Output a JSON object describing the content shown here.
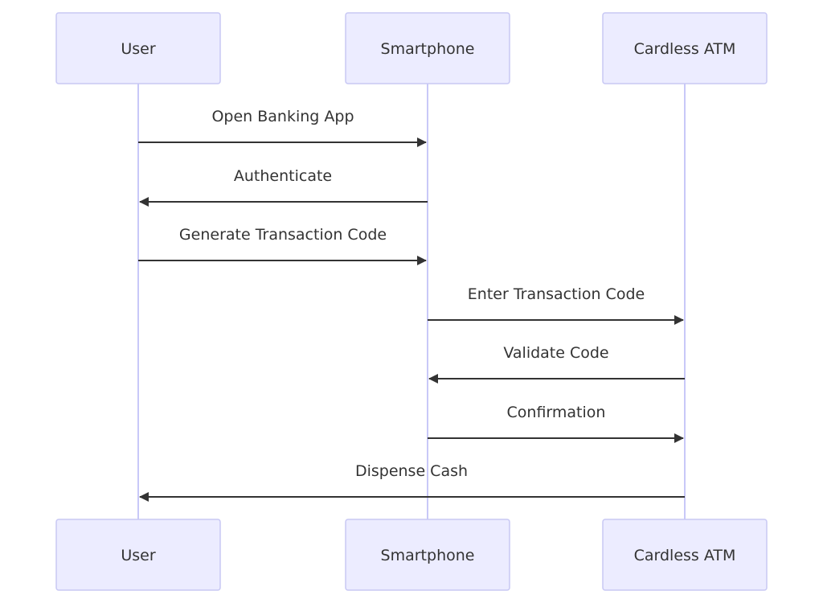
{
  "diagram": {
    "type": "sequence",
    "participants": [
      {
        "id": "user",
        "label": "User"
      },
      {
        "id": "phone",
        "label": "Smartphone"
      },
      {
        "id": "atm",
        "label": "Cardless ATM"
      }
    ],
    "messages": [
      {
        "from": "user",
        "to": "phone",
        "label": "Open Banking App"
      },
      {
        "from": "phone",
        "to": "user",
        "label": "Authenticate"
      },
      {
        "from": "user",
        "to": "phone",
        "label": "Generate Transaction Code"
      },
      {
        "from": "phone",
        "to": "atm",
        "label": "Enter Transaction Code"
      },
      {
        "from": "atm",
        "to": "phone",
        "label": "Validate Code"
      },
      {
        "from": "phone",
        "to": "atm",
        "label": "Confirmation"
      },
      {
        "from": "atm",
        "to": "user",
        "label": "Dispense Cash"
      }
    ],
    "colors": {
      "actor_fill": "#ECECFF",
      "actor_border": "#C8C8F4",
      "lifeline": "#C8C8F8",
      "arrow": "#333333",
      "text": "#333333"
    }
  }
}
